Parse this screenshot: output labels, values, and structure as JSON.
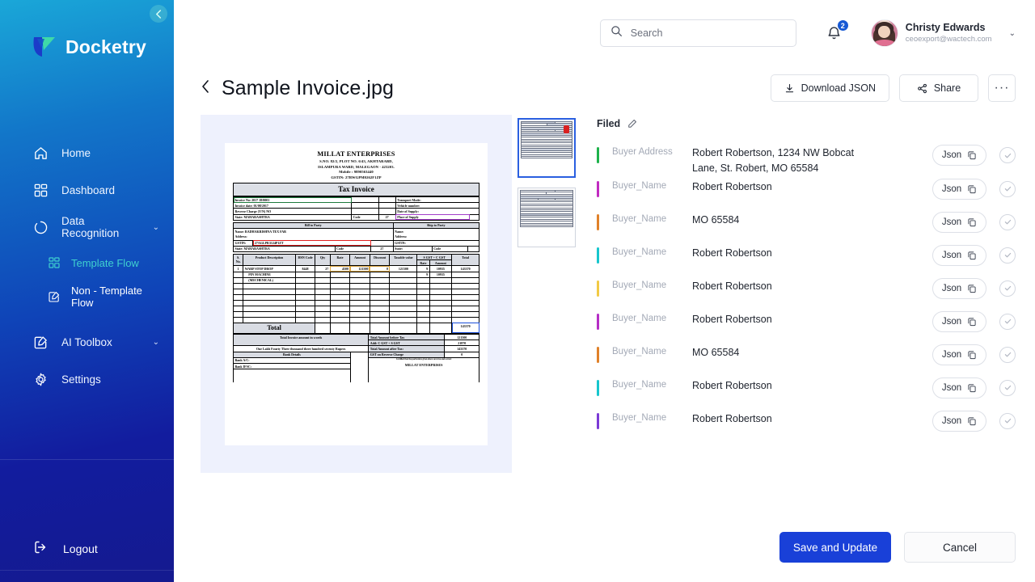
{
  "sidebar": {
    "collapse_icon": "chevron-left-icon",
    "brand": "Docketry",
    "items": [
      {
        "label": "Home",
        "icon": "home-icon",
        "expandable": false
      },
      {
        "label": "Dashboard",
        "icon": "dashboard-icon",
        "expandable": false
      },
      {
        "label": "Data Recognition",
        "icon": "data-recognition-icon",
        "expandable": true,
        "chevron": "⌄"
      }
    ],
    "sub_items": [
      {
        "label": "Template Flow",
        "icon": "template-flow-icon",
        "active": false
      },
      {
        "label": "Non - Template Flow",
        "icon": "non-template-flow-icon",
        "active": true
      }
    ],
    "items_2": [
      {
        "label": "AI Toolbox",
        "icon": "ai-toolbox-icon",
        "expandable": true,
        "chevron": "⌄"
      },
      {
        "label": "Settings",
        "icon": "gear-icon",
        "expandable": false
      }
    ],
    "logout": {
      "label": "Logout",
      "icon": "logout-icon"
    }
  },
  "topbar": {
    "search": {
      "placeholder": "Search",
      "value": "",
      "icon": "search-icon"
    },
    "notifications": {
      "icon": "bell-icon",
      "count": "2"
    },
    "user": {
      "name": "Christy Edwards",
      "email": "ceoexport@wactech.com",
      "chevron": "⌄",
      "avatar": "avatar"
    }
  },
  "page": {
    "back_icon": "chevron-left-icon",
    "title": "Sample Invoice.jpg",
    "actions": {
      "download_json": {
        "label": "Download JSON",
        "icon": "download-icon"
      },
      "share": {
        "label": "Share",
        "icon": "share-icon"
      },
      "more": {
        "label": "···",
        "icon": "more-horizontal-icon"
      }
    }
  },
  "fields_panel": {
    "header": {
      "label": "Filed",
      "edit_icon": "pencil-icon"
    },
    "pill_label": "Json",
    "copy_icon": "copy-icon",
    "check_icon": "check-circle-icon",
    "rows": [
      {
        "label": "Buyer Address",
        "value": "Robert Robertson, 1234 NW Bobcat Lane, St. Robert, MO 65584",
        "color": "#1eb24b"
      },
      {
        "label": "Buyer_Name",
        "value": "Robert Robertson",
        "color": "#c12bc1"
      },
      {
        "label": "Buyer_Name",
        "value": "MO 65584",
        "color": "#e08129"
      },
      {
        "label": "Buyer_Name",
        "value": "Robert Robertson",
        "color": "#17c6cd"
      },
      {
        "label": "Buyer_Name",
        "value": "Robert Robertson",
        "color": "#f2ca45"
      },
      {
        "label": "Buyer_Name",
        "value": "Robert Robertson",
        "color": "#b52ec6"
      },
      {
        "label": "Buyer_Name",
        "value": "MO 65584",
        "color": "#e08129"
      },
      {
        "label": "Buyer_Name",
        "value": "Robert Robertson",
        "color": "#17c6cd"
      },
      {
        "label": "Buyer_Name",
        "value": "Robert Robertson",
        "color": "#7b3ad6"
      }
    ]
  },
  "footer": {
    "save_label": "Save and Update",
    "cancel_label": "Cancel"
  },
  "document_preview": {
    "thumbnails": [
      {
        "name": "page-1-thumbnail",
        "selected": true
      },
      {
        "name": "page-2-thumbnail",
        "selected": false
      }
    ],
    "invoice": {
      "company": "MILLAT ENTERPRISES",
      "address_line1": "S.NO. 82/2, PLOT NO. 6/43, AKHTARABD,",
      "address_line2": "ISLAMPURA WARD, MALEGAON - 423203.",
      "mobile": "Mobile : 9890563440",
      "gstin": "GSTIN: 27BWGPM0262F1ZP",
      "title": "Tax Invoice",
      "invoice_no_label": "Invoice No: 2017 18/0001",
      "invoice_date_label": "Invoice date:  01/08/2017",
      "reverse_charge_label": "Reverse Charge (Y/N)  NO",
      "state_label": "State:  MAHARASHTRA",
      "code_label": "Code",
      "code_value": "27",
      "transport_mode": "Transport Mode:",
      "vehicle_number": "Vehicle number:",
      "date_of_supply": "Date of Supply:",
      "place_of_supply": "Place of Supply",
      "bill_to_party": "Bill to Party",
      "ship_to_party": "Ship to Party",
      "bill_name": "Name:  RADHAKRISHNA TEX FAB",
      "bill_address": "Address:",
      "bill_gstin_label": "GSTIN:",
      "bill_gstin_value": "27AGLPR3124P1ZT",
      "bill_state": "State:    MAHARASHTRA",
      "ship_name": "Name:",
      "ship_address": "Address:",
      "ship_gstin": "GSTIN:",
      "ship_state": "State:",
      "columns": [
        "S. No.",
        "Product Description",
        "HSN Code",
        "Qty",
        "Rate",
        "Amount",
        "Discount",
        "Taxable value",
        "Rate",
        "Amount",
        "Total"
      ],
      "gst_group_header": "S GST  +  C GST",
      "line_items": [
        {
          "sno": "1",
          "desc": "WARP STOP DROP",
          "hsn": "8448",
          "qty": "27",
          "rate": "4500",
          "amount": "121500",
          "discount": "0",
          "taxable": "121500",
          "gst_rate": "9",
          "gst_amount": "10935",
          "total": "143370"
        },
        {
          "sno": "",
          "desc": "PIN MACHINE",
          "hsn": "",
          "qty": "",
          "rate": "",
          "amount": "",
          "discount": "",
          "taxable": "",
          "gst_rate": "9",
          "gst_amount": "10935",
          "total": ""
        },
        {
          "sno": "",
          "desc": "(MECHENICAL)",
          "hsn": "",
          "qty": "",
          "rate": "",
          "amount": "",
          "discount": "",
          "taxable": "",
          "gst_rate": "",
          "gst_amount": "",
          "total": ""
        }
      ],
      "total_label": "Total",
      "total_value": "143370",
      "amount_in_words_label": "Total Invoice amount in words",
      "amount_in_words": "One Lakh Fourty Three thousand three hundred seventy Rupees",
      "bank_details_label": "Bank Details",
      "bank_ac": "Bank A/C:",
      "bank_ifsc": "Bank IFSC:",
      "summary": [
        {
          "label": "Total Amount before Tax",
          "value": "121500"
        },
        {
          "label": "Add: C  GST   +   S   GST",
          "value": "21870"
        },
        {
          "label": "Total Amount after Tax:",
          "value": "143370"
        },
        {
          "label": "GST on Reverse Charge",
          "value": "0"
        }
      ],
      "certify_note": "Certified that the particulars given above are true and correct",
      "sign_company": "MILLAT ENTERPRISES"
    }
  }
}
